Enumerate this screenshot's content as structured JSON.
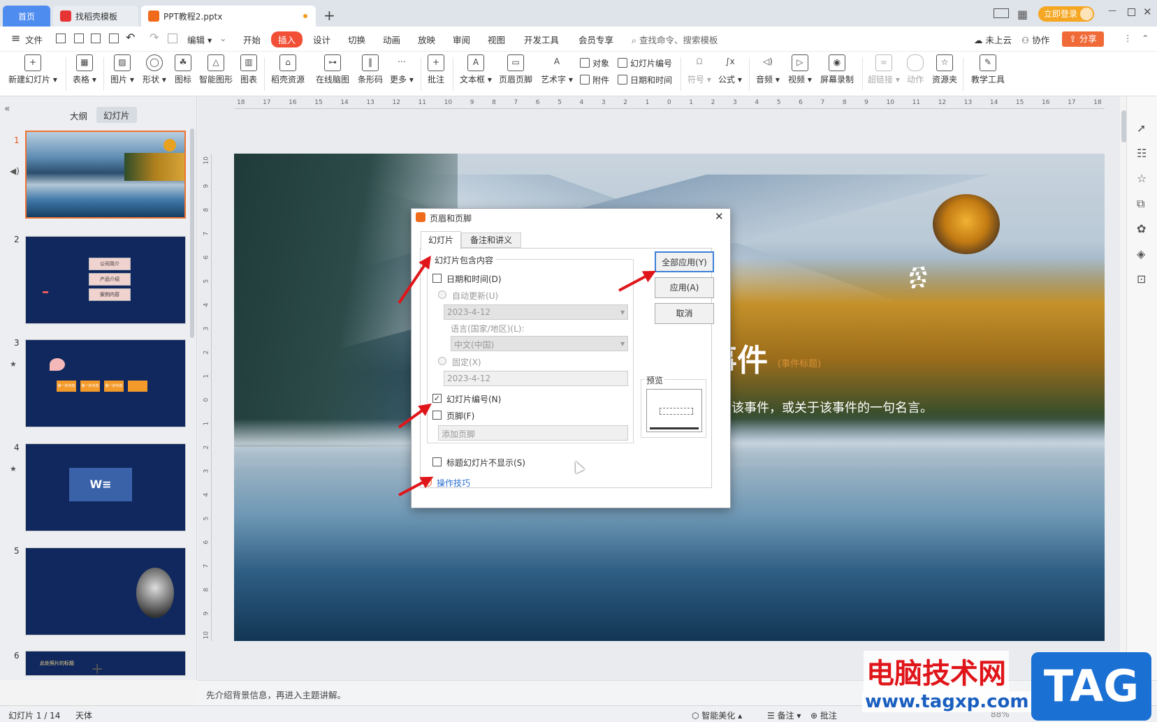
{
  "tabs": [
    {
      "label": "首页"
    },
    {
      "label": "找稻壳模板"
    },
    {
      "label": "PPT教程2.pptx"
    }
  ],
  "topright": {
    "login": "立即登录"
  },
  "menu": {
    "file": "文件",
    "edit": "编辑",
    "items": [
      "开始",
      "插入",
      "设计",
      "切换",
      "动画",
      "放映",
      "审阅",
      "视图",
      "开发工具",
      "会员专享"
    ],
    "search": "查找命令、搜索模板",
    "cloud": "未上云",
    "collab": "协作",
    "share": "分享"
  },
  "ribbon": {
    "new_slide": "新建幻灯片",
    "table": "表格",
    "picture": "图片",
    "shape": "形状",
    "icon": "图标",
    "smart": "智能图形",
    "chart": "图表",
    "daoke": "稻壳资源",
    "mind": "在线脑图",
    "barcode": "条形码",
    "more": "更多",
    "comment": "批注",
    "textbox": "文本框",
    "header_footer": "页眉页脚",
    "art": "艺术字",
    "object": "对象",
    "attachment": "附件",
    "slide_no": "幻灯片编号",
    "datetime": "日期和时间",
    "symbol": "符号",
    "formula": "公式",
    "audio": "音频",
    "video": "视频",
    "record": "屏幕录制",
    "hyperlink": "超链接",
    "action": "动作",
    "resource": "资源夹",
    "teach": "教学工具"
  },
  "leftpane": {
    "outline_tab": "大纲",
    "slides_tab": "幻灯片",
    "nums": [
      "1",
      "2",
      "3",
      "4",
      "5",
      "6"
    ],
    "s2": [
      "公司简介",
      "产品介绍",
      "案例内容"
    ],
    "s6title": "此处照片的标题",
    "s3text": "第一步内容"
  },
  "slide": {
    "title": "事件",
    "subtitle": "(事件标题)",
    "desc": "总结该事件，或关于该事件的一句名言。"
  },
  "ruler": {
    "h": [
      "18",
      "17",
      "16",
      "15",
      "14",
      "13",
      "12",
      "11",
      "10",
      "9",
      "8",
      "7",
      "6",
      "5",
      "4",
      "3",
      "2",
      "1",
      "0",
      "1",
      "2",
      "3",
      "4",
      "5",
      "6",
      "7",
      "8",
      "9",
      "10",
      "11",
      "12",
      "13",
      "14",
      "15",
      "16",
      "17",
      "18"
    ],
    "v": [
      "10",
      "9",
      "8",
      "7",
      "6",
      "5",
      "4",
      "3",
      "2",
      "1",
      "0",
      "1",
      "2",
      "3",
      "4",
      "5",
      "6",
      "7",
      "8",
      "9",
      "10"
    ]
  },
  "dialog": {
    "title": "页眉和页脚",
    "tab_slide": "幻灯片",
    "tab_notes": "备注和讲义",
    "group": "幻灯片包含内容",
    "datetime": "日期和时间(D)",
    "auto": "自动更新(U)",
    "date1": "2023-4-12",
    "lang": "语言(国家/地区)(L):",
    "lang_val": "中文(中国)",
    "fixed": "固定(X)",
    "date2": "2023-4-12",
    "slide_no": "幻灯片编号(N)",
    "slide_no_checked": true,
    "footer": "页脚(F)",
    "footer_placeholder": "添加页脚",
    "no_title": "标题幻灯片不显示(S)",
    "tips": "操作技巧",
    "preview": "预览",
    "apply_all": "全部应用(Y)",
    "apply": "应用(A)",
    "cancel": "取消"
  },
  "notes": "先介绍背景信息，再进入主题讲解。",
  "status": {
    "slide": "幻灯片 1 / 14",
    "theme": "天体",
    "beautify": "智能美化",
    "notes": "备注",
    "comment": "批注",
    "zoom": "88%"
  },
  "watermark": {
    "cn": "电脑技术网",
    "url": "www.tagxp.com",
    "tag": "TAG"
  }
}
